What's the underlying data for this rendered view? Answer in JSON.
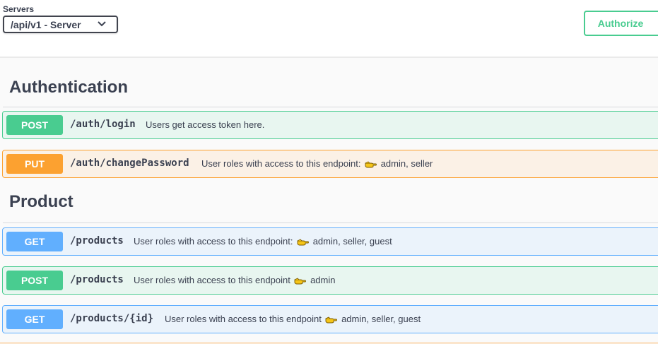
{
  "servers": {
    "label": "Servers",
    "selected": "/api/v1 - Server"
  },
  "authorize_label": "Authorize",
  "colors": {
    "post": "#49cc90",
    "put": "#fca130",
    "get": "#61affe",
    "text": "#3b4151"
  },
  "tags": [
    {
      "name": "Authentication",
      "operations": [
        {
          "method": "POST",
          "path": "/auth/login",
          "summary": "Users get access token here.",
          "roles": ""
        },
        {
          "method": "PUT",
          "path": "/auth/changePassword",
          "summary": "User roles with access to this endpoint:",
          "roles": "admin, seller"
        }
      ]
    },
    {
      "name": "Product",
      "operations": [
        {
          "method": "GET",
          "path": "/products",
          "summary": "User roles with access to this endpoint:",
          "roles": "admin, seller, guest"
        },
        {
          "method": "POST",
          "path": "/products",
          "summary": "User roles with access to this endpoint",
          "roles": "admin"
        },
        {
          "method": "GET",
          "path": "/products/{id}",
          "summary": "User roles with access to this endpoint",
          "roles": "admin, seller, guest"
        }
      ]
    }
  ],
  "icons": {
    "server_select": "chevron-down-icon",
    "role_marker": "pointing-hand-icon"
  }
}
